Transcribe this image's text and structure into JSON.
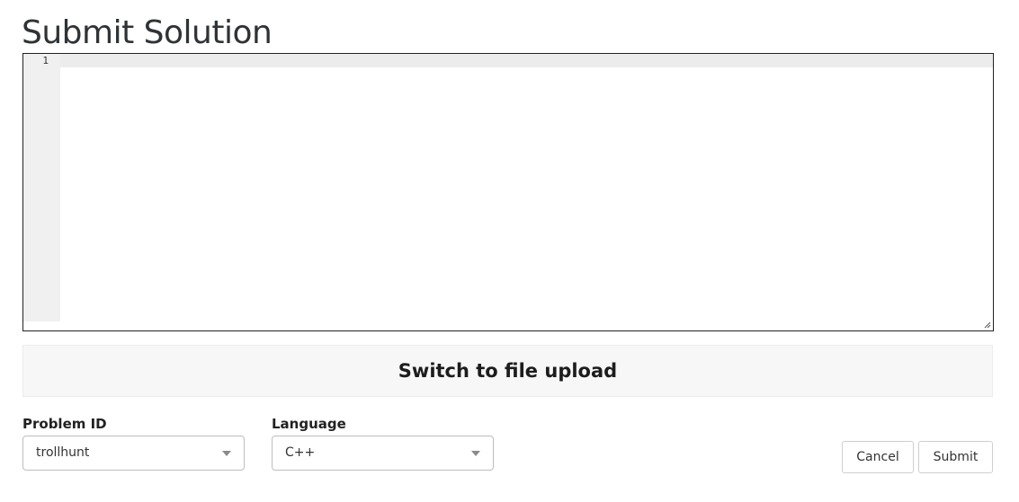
{
  "page": {
    "title": "Submit Solution"
  },
  "editor": {
    "line_numbers": [
      "1"
    ],
    "content": ""
  },
  "upload_toggle": {
    "label": "Switch to file upload"
  },
  "form": {
    "problem": {
      "label": "Problem ID",
      "selected": "trollhunt"
    },
    "language": {
      "label": "Language",
      "selected": "C++"
    }
  },
  "actions": {
    "cancel_label": "Cancel",
    "submit_label": "Submit"
  },
  "icons": {
    "select_arrow": "caret-down-icon",
    "resize": "resize-handle-icon"
  },
  "colors": {
    "title": "#2f3336",
    "gutter": "#f0f0f0",
    "panel": "#f7f7f7",
    "border": "#bdbdbd"
  }
}
